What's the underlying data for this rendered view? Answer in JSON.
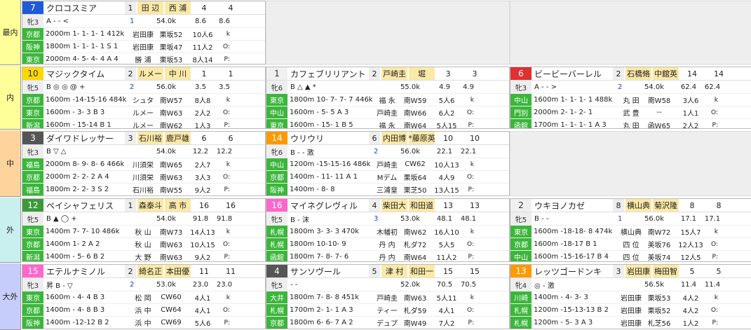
{
  "sections": [
    {
      "label": "最内",
      "color": "#ffff99"
    },
    {
      "label": "内",
      "color": "#ffff99"
    },
    {
      "label": "中",
      "color": "#ffd49c"
    },
    {
      "label": "外",
      "color": "#c9f0ef"
    },
    {
      "label": "大外",
      "color": "#c7cdfb"
    }
  ],
  "horses": [
    {
      "num": "7",
      "name": "クロコスミア",
      "pop": "1",
      "jockey": "田 辺",
      "trainer": "西 浦",
      "odds": "4",
      "rank": "4",
      "sex": "牝3",
      "marks": "A - - <",
      "wtA": "1",
      "wtB": "54.0k",
      "stats": "8.6",
      "stats2": "8.6",
      "recs": [
        {
          "place": "京都",
          "text": "2000m 1- 1- 1- 1 412k",
          "j": "岩田康",
          "w": "栗坂52",
          "r": "10人6",
          "x": "k"
        },
        {
          "place": "阪神",
          "text": "1800m 1- 1- 1- 1 S 1",
          "j": "岩田康",
          "w": "栗坂47",
          "r": "11人2",
          "x": "O:"
        },
        {
          "place": "東京",
          "text": "2000m 4- 5- 4- 4 A 4",
          "j": "勝 浦",
          "w": "栗坂53",
          "r": "8人14",
          "x": "P:"
        }
      ]
    },
    {
      "num": "10",
      "name": "マジックタイム",
      "pop": "2",
      "jockey": "ルメー",
      "trainer": "中 川",
      "odds": "1",
      "rank": "1",
      "sex": "牝5",
      "marks": "B ◎ ◎ @ +",
      "wtA": "2",
      "wtB": "56.0k",
      "stats": "3.5",
      "stats2": "3.5",
      "recs": [
        {
          "place": "京都",
          "text": "1600m -14-15-16 484k",
          "j": "シュタ",
          "w": "南W57",
          "r": "8人8",
          "x": "k"
        },
        {
          "place": "東京",
          "text": "1600m - 3- 3 B 3",
          "j": "ルメー",
          "w": "南W63",
          "r": "2人2",
          "x": "O:"
        },
        {
          "place": "新潟",
          "text": "1600m - 15-14 B 1",
          "j": "ルメー",
          "w": "南W62",
          "r": "1人3",
          "x": "P:"
        }
      ]
    },
    {
      "num": "1",
      "name": "カフェブリリアント",
      "pop": "2",
      "jockey": "戸崎圭",
      "trainer": "堀",
      "odds": "3",
      "rank": "3",
      "sex": "牝6",
      "marks": "B △ ▲ *",
      "wtA": "",
      "wtB": "55.0k",
      "stats": "4.9",
      "stats2": "4.9",
      "recs": [
        {
          "place": "東京",
          "text": "1800m 10- 7- 7- 7 446k",
          "j": "福 永",
          "w": "南W59",
          "r": "5人6",
          "x": "k"
        },
        {
          "place": "中山",
          "text": "1600m - 5- 5 A 3",
          "j": "戸崎圭",
          "w": "南W66",
          "r": "6人2",
          "x": "O:"
        },
        {
          "place": "東京",
          "text": "1600m - 15- 1 B 5",
          "j": "福 永",
          "w": "南W64",
          "r": "5人15",
          "x": "P:"
        }
      ]
    },
    {
      "num": "6",
      "name": "ビービーバーレル",
      "pop": "2",
      "jockey": "石橋脩",
      "trainer": "中舘英",
      "odds": "14",
      "rank": "14",
      "sex": "牝3",
      "marks": "A - - >",
      "wtA": "2",
      "wtB": "54.0k",
      "stats": "62.4",
      "stats2": "62.4",
      "recs": [
        {
          "place": "中山",
          "text": "1600m 1- 1- 1- 1 488k",
          "j": "丸 田",
          "w": "南W58",
          "r": "3人6",
          "x": "k"
        },
        {
          "place": "門別",
          "text": "2000m 2- 1- 2- 1",
          "j": "武 豊",
          "w": "--",
          "r": "1人1",
          "x": "O:"
        },
        {
          "place": "函館",
          "text": "1700m 1- 1- 1- 1 A 3",
          "j": "丸 田",
          "w": "函W65",
          "r": "2人2",
          "x": "P:"
        }
      ]
    },
    {
      "num": "3",
      "name": "ダイワドレッサー",
      "pop": "3",
      "jockey": "石川裕",
      "trainer": "鹿戸雄",
      "odds": "6",
      "rank": "6",
      "sex": "牝3",
      "marks": "B ▽ △",
      "wtA": "",
      "wtB": "54.0k",
      "stats": "12.2",
      "stats2": "12.2",
      "recs": [
        {
          "place": "福島",
          "text": "2000m 8- 9- 8- 6 466k",
          "j": "川須栄",
          "w": "南W65",
          "r": "2人7",
          "x": "k"
        },
        {
          "place": "京都",
          "text": "2000m 2- 2- 2 A 4",
          "j": "川須栄",
          "w": "南W63",
          "r": "3人3",
          "x": "O:"
        },
        {
          "place": "福島",
          "text": "1800m 2- 2- 3 S 2",
          "j": "石川裕",
          "w": "南W55",
          "r": "9人2",
          "x": "P:"
        }
      ]
    },
    {
      "num": "14",
      "name": "ウリウリ",
      "pop": "6",
      "jockey": "内田博",
      "trainer": "*藤原英",
      "odds": "10",
      "rank": "10",
      "sex": "牝6",
      "marks": "B - - 激",
      "wtA": "2",
      "wtB": "56.0k",
      "stats": "22.1",
      "stats2": "22.1",
      "recs": [
        {
          "place": "中山",
          "text": "1200m -15-15-16 486k",
          "j": "戸崎圭",
          "w": "CW62",
          "r": "10人13",
          "x": "k"
        },
        {
          "place": "京都",
          "text": "1400m - 11- 11 A 1",
          "j": "Mデム",
          "w": "栗坂64",
          "r": "4人9",
          "x": "O:"
        },
        {
          "place": "阪神",
          "text": "1400m - 8- 8",
          "j": "三浦皇",
          "w": "栗芝50",
          "r": "13人15",
          "x": "P:"
        }
      ]
    },
    {
      "num": "12",
      "name": "ペイシャフェリス",
      "pop": "1",
      "jockey": "森泰斗",
      "trainer": "高 市",
      "odds": "16",
      "rank": "16",
      "sex": "牝5",
      "marks": "B ▲ ◯ +",
      "wtA": "",
      "wtB": "54.0k",
      "stats": "91.8",
      "stats2": "91.8",
      "recs": [
        {
          "place": "東京",
          "text": "1400m 7- 7- 10 486k",
          "j": "秋 山",
          "w": "南W73",
          "r": "14人13",
          "x": "k"
        },
        {
          "place": "京都",
          "text": "1400m 1- 2 A 2",
          "j": "秋 山",
          "w": "南W63",
          "r": "10人15",
          "x": "O:"
        },
        {
          "place": "新潟",
          "text": "1400m - 5- 6 B 2",
          "j": "大 野",
          "w": "南W63",
          "r": "9人2",
          "x": "P:"
        }
      ]
    },
    {
      "num": "16",
      "name": "マイネグレヴィル",
      "pop": "4",
      "jockey": "柴田大",
      "trainer": "和田道",
      "odds": "13",
      "rank": "13",
      "sex": "牝5",
      "marks": "B - 沫",
      "wtA": "3",
      "wtB": "53.0k",
      "stats": "48.1",
      "stats2": "48.1",
      "recs": [
        {
          "place": "札幌",
          "text": "1800m 3- 3- 3 470k",
          "j": "木幡初",
          "w": "南W62",
          "r": "16人10",
          "x": "k"
        },
        {
          "place": "札幌",
          "text": "1800m 10-10- 9",
          "j": "丹 内",
          "w": "札ダ72",
          "r": "5人5",
          "x": "O:"
        },
        {
          "place": "函館",
          "text": "1800m 7- 8- 7- 6",
          "j": "丹 内",
          "w": "南W64",
          "r": "11人2",
          "x": "P:"
        }
      ]
    },
    {
      "num": "2",
      "name": "ウキヨノカゼ",
      "pop": "8",
      "jockey": "横山典",
      "trainer": "菊沢隆",
      "odds": "8",
      "rank": "8",
      "sex": "牝5",
      "marks": "B - -",
      "wtA": "1",
      "wtB": "56.0k",
      "stats": "17.1",
      "stats2": "17.1",
      "recs": [
        {
          "place": "東京",
          "text": "1600m -18-18- 8 474k",
          "j": "横山典",
          "w": "南W72",
          "r": "15人7",
          "x": "k"
        },
        {
          "place": "京都",
          "text": "1600m -18-17 B 1",
          "j": "四 位",
          "w": "美坂76",
          "r": "12人13",
          "x": "O:"
        },
        {
          "place": "中山",
          "text": "1600m -15-16-17 B 4",
          "j": "四 位",
          "w": "美坂74",
          "r": "12人5",
          "x": "P:"
        }
      ]
    },
    {
      "num": "15",
      "name": "エテルナミノル",
      "pop": "2",
      "jockey": "綺名正",
      "trainer": "本田優",
      "odds": "11",
      "rank": "11",
      "sex": "牝3",
      "marks": "昇 B - ▽",
      "wtA": "2",
      "wtB": "53.0k",
      "stats": "23.0",
      "stats2": "23.0",
      "recs": [
        {
          "place": "東京",
          "text": "1600m - 4- 4 B 3",
          "j": "松 岡",
          "w": "CW60",
          "r": "4人1",
          "x": "k"
        },
        {
          "place": "京都",
          "text": "1400m - 4- 8 B 3",
          "j": "浜 中",
          "w": "CW64",
          "r": "4人1",
          "x": "O:"
        },
        {
          "place": "阪神",
          "text": "1400m -12-12 B 2",
          "j": "浜 中",
          "w": "CW69",
          "r": "5人6",
          "x": "P:"
        }
      ]
    },
    {
      "num": "4",
      "name": "サンソヴール",
      "pop": "5",
      "jockey": "津 村",
      "trainer": "和田一",
      "odds": "15",
      "rank": "15",
      "sex": "牝5",
      "marks": "- -",
      "wtA": "",
      "wtB": "52.0k",
      "stats": "70.5",
      "stats2": "70.5",
      "recs": [
        {
          "place": "大井",
          "text": "1800m 7- 8- 8 451k",
          "j": "戸崎圭",
          "w": "南W63",
          "r": "5人11",
          "x": "k"
        },
        {
          "place": "札幌",
          "text": "1700m 2- 1- 1 A 3",
          "j": "ティー",
          "w": "札ダ59",
          "r": "4人1",
          "x": "O:"
        },
        {
          "place": "京都",
          "text": "1800m 6- 6- 7 A 2",
          "j": "デュプ",
          "w": "南W49",
          "r": "7人2",
          "x": "P:"
        }
      ]
    },
    {
      "num": "13",
      "name": "レッツゴードンキ",
      "pop": "3",
      "jockey": "岩田康",
      "trainer": "梅田智",
      "odds": "5",
      "rank": "5",
      "sex": "牝4",
      "marks": "◎ - 激",
      "wtA": "",
      "wtB": "56.5k",
      "stats": "11.4",
      "stats2": "11.4",
      "recs": [
        {
          "place": "川崎",
          "text": "1400m - 4- 3- 3",
          "j": "岩田康",
          "w": "栗坂53",
          "r": "4人2",
          "x": "k"
        },
        {
          "place": "札幌",
          "text": "1200m -15-13-13 B 2",
          "j": "岩田康",
          "w": "栗坂52",
          "r": "4人2",
          "x": "O:"
        },
        {
          "place": "札幌",
          "text": "1200m - 5- 3 A 3",
          "j": "岩田康",
          "w": "札芝56",
          "r": "1人2",
          "x": "P:"
        }
      ]
    }
  ],
  "colors": {
    "gate_blue": "#1f5bd8",
    "gate_yellow": "#ffd700",
    "gate_black": "#555",
    "gate_orange": "#ff9900",
    "gate_green": "#3c9a3c",
    "gate_pink": "#ff66cc",
    "gate_red": "#e03030",
    "place": "#3bb63b"
  }
}
